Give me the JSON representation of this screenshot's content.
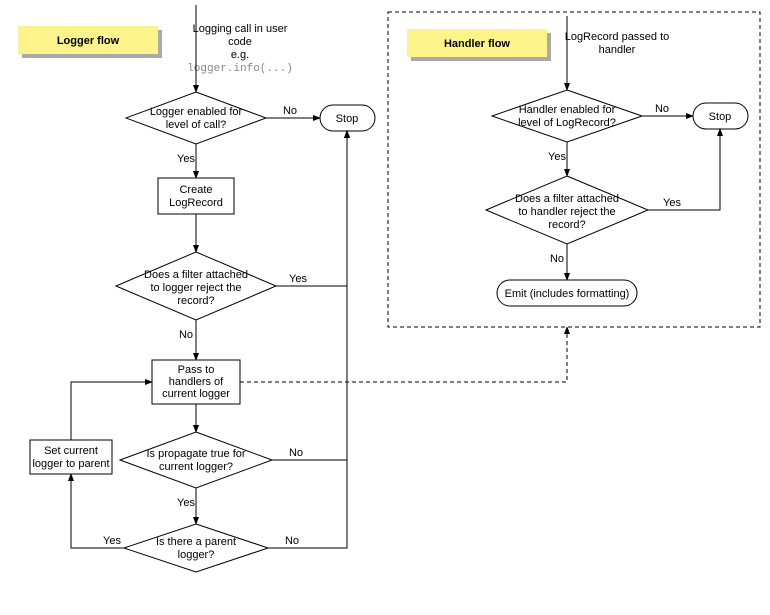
{
  "titles": {
    "logger_flow": "Logger flow",
    "handler_flow": "Handler flow"
  },
  "logger": {
    "start_l1": "Logging call in user",
    "start_l2": "code",
    "start_l3": "e.g.",
    "start_code": "logger.info(...)",
    "d1_l1": "Logger enabled for",
    "d1_l2": "level of call?",
    "d1_yes": "Yes",
    "d1_no": "No",
    "stop": "Stop",
    "create_l1": "Create",
    "create_l2": "LogRecord",
    "d2_l1": "Does a filter attached",
    "d2_l2": "to logger reject the",
    "d2_l3": "record?",
    "d2_yes": "Yes",
    "d2_no": "No",
    "pass_l1": "Pass to",
    "pass_l2": "handlers of",
    "pass_l3": "current logger",
    "d3_l1": "Is propagate true for",
    "d3_l2": "current logger?",
    "d3_yes": "Yes",
    "d3_no": "No",
    "d4_l1": "Is there a parent",
    "d4_l2": "logger?",
    "d4_yes": "Yes",
    "d4_no": "No",
    "setparent_l1": "Set current",
    "setparent_l2": "logger to parent"
  },
  "handler": {
    "start_l1": "LogRecord passed to",
    "start_l2": "handler",
    "d1_l1": "Handler enabled for",
    "d1_l2": "level of LogRecord?",
    "d1_yes": "Yes",
    "d1_no": "No",
    "stop": "Stop",
    "d2_l1": "Does a filter attached",
    "d2_l2": "to handler reject the",
    "d2_l3": "record?",
    "d2_yes": "Yes",
    "d2_no": "No",
    "emit": "Emit (includes formatting)"
  }
}
